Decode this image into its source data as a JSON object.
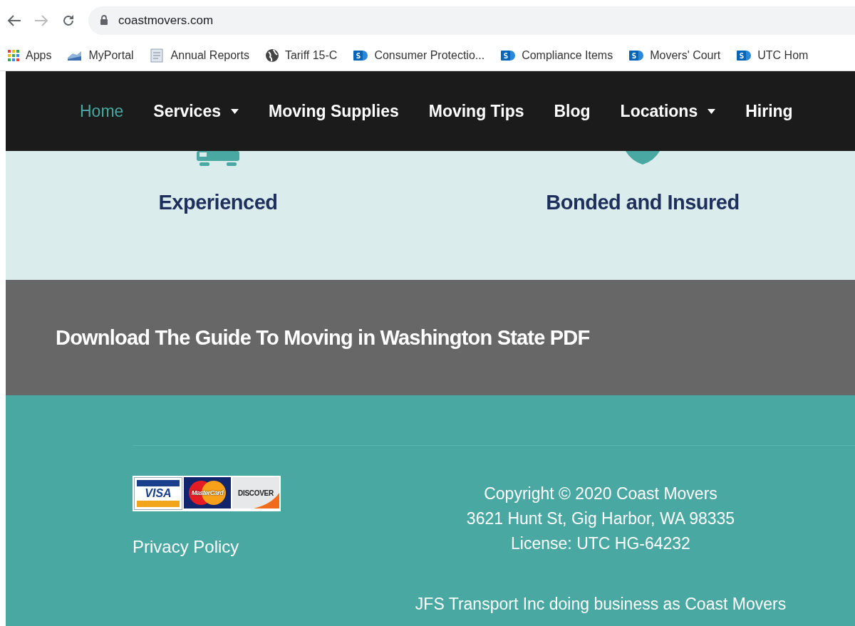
{
  "browser": {
    "url": "coastmovers.com",
    "bookmarks": [
      {
        "label": "Apps",
        "kind": "apps"
      },
      {
        "label": "MyPortal",
        "kind": "chart"
      },
      {
        "label": "Annual Reports",
        "kind": "doc"
      },
      {
        "label": "Tariff 15-C",
        "kind": "globe"
      },
      {
        "label": "Consumer Protectio...",
        "kind": "sharepoint"
      },
      {
        "label": "Compliance Items",
        "kind": "sharepoint"
      },
      {
        "label": "Movers' Court",
        "kind": "sharepoint"
      },
      {
        "label": "UTC Hom",
        "kind": "sharepoint"
      }
    ]
  },
  "nav": {
    "items": [
      {
        "label": "Home",
        "selected": true,
        "dropdown": false
      },
      {
        "label": "Services",
        "selected": false,
        "dropdown": true
      },
      {
        "label": "Moving Supplies",
        "selected": false,
        "dropdown": false
      },
      {
        "label": "Moving Tips",
        "selected": false,
        "dropdown": false
      },
      {
        "label": "Blog",
        "selected": false,
        "dropdown": false
      },
      {
        "label": "Locations",
        "selected": false,
        "dropdown": true
      },
      {
        "label": "Hiring",
        "selected": false,
        "dropdown": false
      }
    ]
  },
  "features": [
    {
      "title": "Experienced",
      "kind": "truck"
    },
    {
      "title": "Bonded and Insured",
      "kind": "shield"
    }
  ],
  "banner": {
    "text": "Download The Guide To Moving in Washington State PDF"
  },
  "footer": {
    "cards": [
      {
        "label": "VISA",
        "kind": "visa"
      },
      {
        "label": "MasterCard",
        "kind": "mastercard"
      },
      {
        "label": "DISCOVER",
        "kind": "discover"
      }
    ],
    "privacy_link": "Privacy Policy",
    "lines": [
      "Copyright © 2020 Coast Movers",
      "3621 Hunt St, Gig Harbor, WA 98335",
      "License: UTC HG-64232"
    ],
    "dba": "JFS Transport Inc doing business as Coast Movers"
  }
}
